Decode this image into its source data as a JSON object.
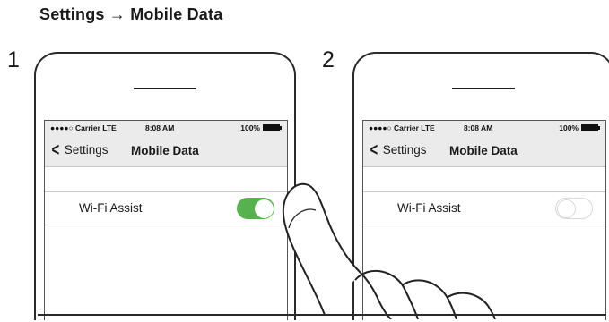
{
  "header": {
    "title": "Settings → Mobile Data"
  },
  "steps": [
    {
      "number": "1",
      "status": {
        "carrier": "●●●●○ Carrier LTE",
        "time": "8:08 AM",
        "battery": "100%"
      },
      "nav": {
        "back_label": "Settings",
        "title": "Mobile Data"
      },
      "row": {
        "label": "Wi-Fi Assist",
        "toggle_on": true
      },
      "accent": "#57b14e"
    },
    {
      "number": "2",
      "status": {
        "carrier": "●●●●○ Carrier LTE",
        "time": "8:08 AM",
        "battery": "100%"
      },
      "nav": {
        "back_label": "Settings",
        "title": "Mobile Data"
      },
      "row": {
        "label": "Wi-Fi Assist",
        "toggle_on": false
      }
    }
  ],
  "icons": [
    "chevron-left-icon",
    "battery-icon",
    "hand-tap-icon",
    "toggle-switch"
  ]
}
